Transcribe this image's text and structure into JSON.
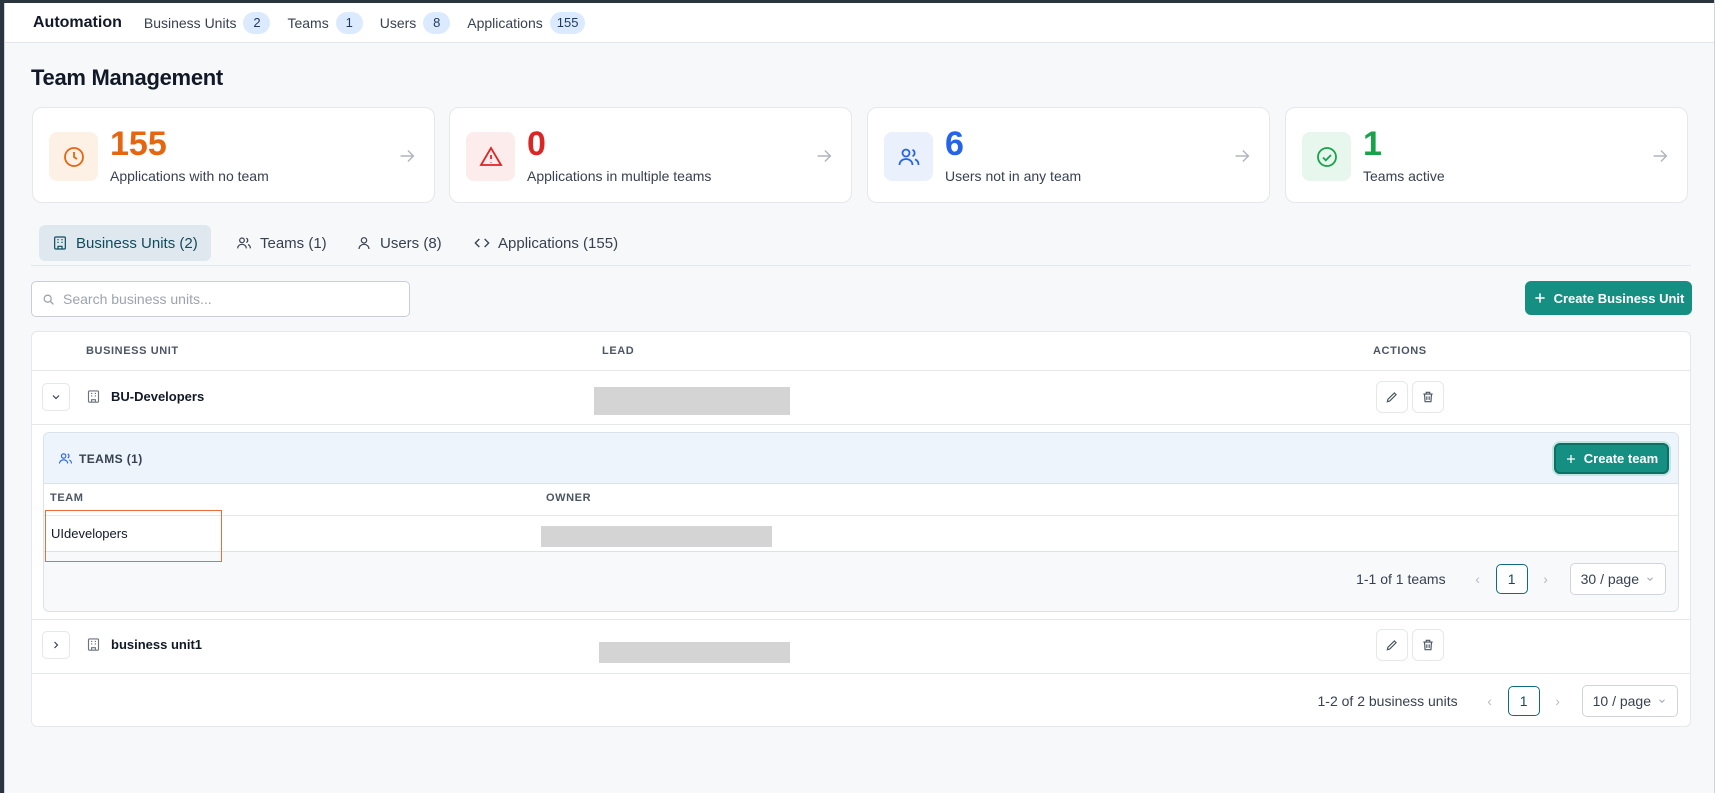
{
  "topnav": {
    "brand": "Automation",
    "items": [
      {
        "label": "Business Units",
        "count": "2"
      },
      {
        "label": "Teams",
        "count": "1"
      },
      {
        "label": "Users",
        "count": "8"
      },
      {
        "label": "Applications",
        "count": "155"
      }
    ]
  },
  "page": {
    "title": "Team Management"
  },
  "stats": [
    {
      "value": "155",
      "label": "Applications with no team",
      "icon": "clock-icon",
      "color": "#e8650f",
      "bg": "#fdf1e6"
    },
    {
      "value": "0",
      "label": "Applications in multiple teams",
      "icon": "alert-triangle-icon",
      "color": "#dc2626",
      "bg": "#fdecec"
    },
    {
      "value": "6",
      "label": "Users not in any team",
      "icon": "users-icon",
      "color": "#2563eb",
      "bg": "#eaf1fd"
    },
    {
      "value": "1",
      "label": "Teams active",
      "icon": "check-circle-icon",
      "color": "#16a34a",
      "bg": "#e8f7ee"
    }
  ],
  "tabs": [
    {
      "label": "Business Units (2)",
      "icon": "building-icon",
      "active": true
    },
    {
      "label": "Teams (1)",
      "icon": "users-icon",
      "active": false
    },
    {
      "label": "Users (8)",
      "icon": "user-icon",
      "active": false
    },
    {
      "label": "Applications (155)",
      "icon": "code-icon",
      "active": false
    }
  ],
  "search": {
    "placeholder": "Search business units..."
  },
  "create_business_unit": "Create Business Unit",
  "table": {
    "headers": {
      "business_unit": "BUSINESS UNIT",
      "lead": "LEAD",
      "actions": "ACTIONS"
    },
    "rows": [
      {
        "name": "BU-Developers",
        "expanded": true
      },
      {
        "name": "business unit1",
        "expanded": false
      }
    ],
    "pagination": {
      "summary": "1-2 of 2 business units",
      "page": "1",
      "page_size": "10 / page"
    }
  },
  "teams_panel": {
    "title": "TEAMS (1)",
    "create_label": "Create team",
    "headers": {
      "team": "TEAM",
      "owner": "OWNER"
    },
    "rows": [
      {
        "name": "UIdevelopers"
      }
    ],
    "pagination": {
      "summary": "1-1 of 1 teams",
      "page": "1",
      "page_size": "30 / page"
    }
  }
}
